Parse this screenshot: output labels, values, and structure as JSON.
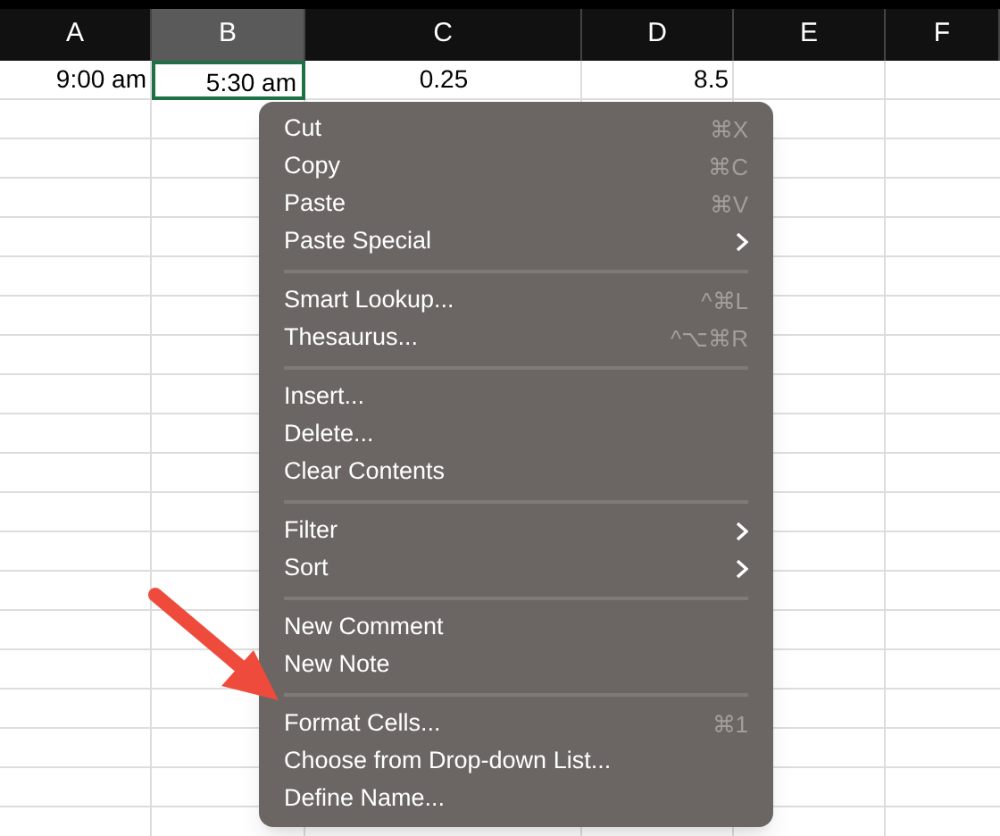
{
  "columns": [
    {
      "label": "A",
      "selected": false
    },
    {
      "label": "B",
      "selected": true
    },
    {
      "label": "C",
      "selected": false
    },
    {
      "label": "D",
      "selected": false
    },
    {
      "label": "E",
      "selected": false
    },
    {
      "label": "F",
      "selected": false
    }
  ],
  "rows": [
    {
      "cells": [
        {
          "text": "9:00 am",
          "selected": false
        },
        {
          "text": "5:30 am",
          "selected": true
        },
        {
          "text": "0.25",
          "selected": false
        },
        {
          "text": "8.5",
          "selected": false
        }
      ]
    }
  ],
  "context_menu": {
    "groups": [
      [
        {
          "label": "Cut",
          "shortcut": "⌘X"
        },
        {
          "label": "Copy",
          "shortcut": "⌘C"
        },
        {
          "label": "Paste",
          "shortcut": "⌘V"
        },
        {
          "label": "Paste Special",
          "submenu": true
        }
      ],
      [
        {
          "label": "Smart Lookup...",
          "shortcut": "^⌘L"
        },
        {
          "label": "Thesaurus...",
          "shortcut": "^⌥⌘R"
        }
      ],
      [
        {
          "label": "Insert..."
        },
        {
          "label": "Delete..."
        },
        {
          "label": "Clear Contents"
        }
      ],
      [
        {
          "label": "Filter",
          "submenu": true
        },
        {
          "label": "Sort",
          "submenu": true
        }
      ],
      [
        {
          "label": "New Comment"
        },
        {
          "label": "New Note"
        }
      ],
      [
        {
          "label": "Format Cells...",
          "shortcut": "⌘1"
        },
        {
          "label": "Choose from Drop-down List..."
        },
        {
          "label": "Define Name..."
        }
      ]
    ]
  }
}
